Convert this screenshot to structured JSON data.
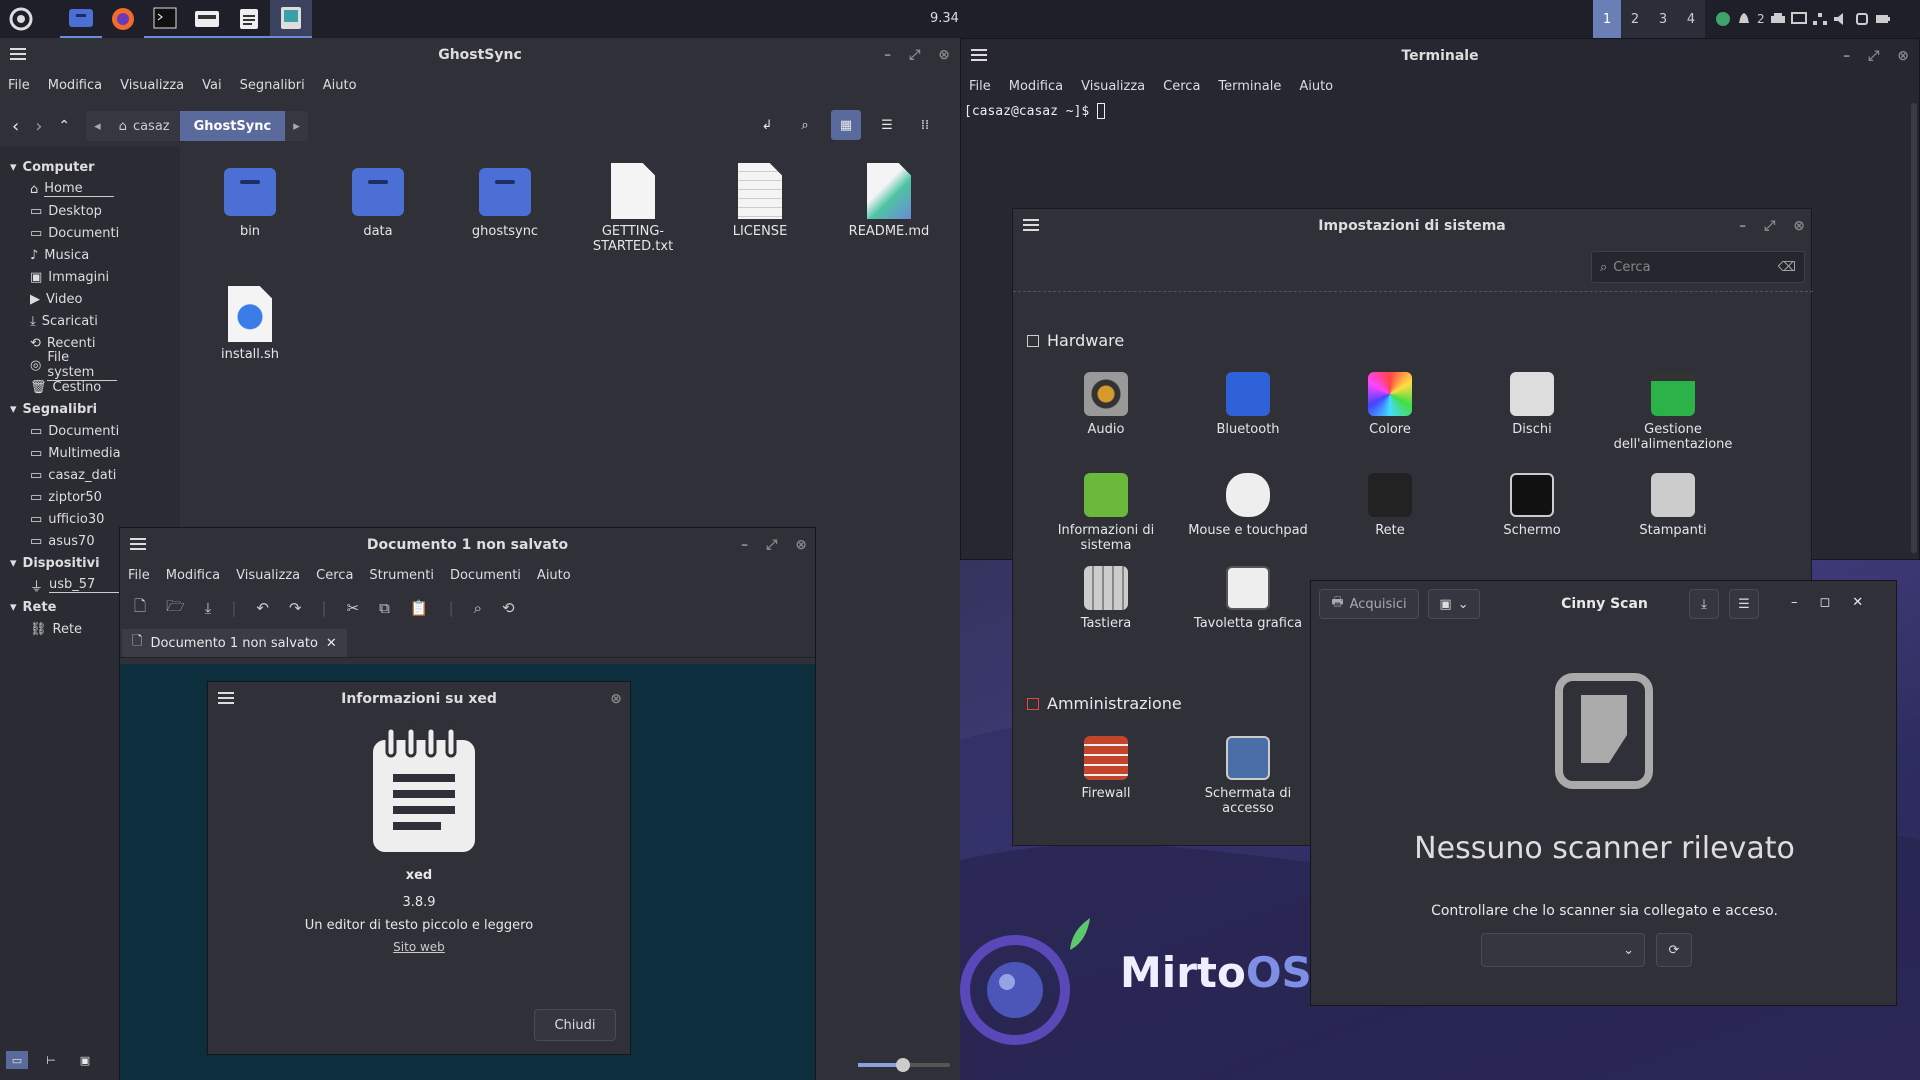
{
  "panel": {
    "clock": "9.34",
    "workspaces": [
      "1",
      "2",
      "3",
      "4"
    ],
    "tray_count": "2",
    "apps": [
      "menu-icon",
      "files-icon",
      "firefox-icon",
      "terminal-icon",
      "scanner-icon",
      "text-editor-icon",
      "settings-icon"
    ]
  },
  "file_manager": {
    "title": "GhostSync",
    "menu": [
      "File",
      "Modifica",
      "Visualizza",
      "Vai",
      "Segnalibri",
      "Aiuto"
    ],
    "path": [
      "casaz",
      "GhostSync"
    ],
    "sidebar": {
      "computer_header": "Computer",
      "computer": [
        "Home",
        "Desktop",
        "Documenti",
        "Musica",
        "Immagini",
        "Video",
        "Scaricati",
        "Recenti",
        "File system",
        "Cestino"
      ],
      "bookmarks_header": "Segnalibri",
      "bookmarks": [
        "Documenti",
        "Multimedia",
        "casaz_dati",
        "ziptor50",
        "ufficio30",
        "asus70"
      ],
      "devices_header": "Dispositivi",
      "devices": [
        "usb_57"
      ],
      "network_header": "Rete",
      "network": [
        "Rete"
      ]
    },
    "files": [
      "bin",
      "data",
      "ghostsync",
      "GETTING-STARTED.txt",
      "LICENSE",
      "README.md",
      "install.sh"
    ]
  },
  "terminal": {
    "title": "Terminale",
    "menu": [
      "File",
      "Modifica",
      "Visualizza",
      "Cerca",
      "Terminale",
      "Aiuto"
    ],
    "prompt": "[casaz@casaz ~]$ "
  },
  "settings": {
    "title": "Impostazioni di sistema",
    "search_placeholder": "Cerca",
    "hardware_header": "Hardware",
    "hardware": [
      "Audio",
      "Bluetooth",
      "Colore",
      "Dischi",
      "Gestione dell'alimentazione",
      "Informazioni di sistema",
      "Mouse e touchpad",
      "Rete",
      "Schermo",
      "Stampanti",
      "Tastiera",
      "Tavoletta grafica"
    ],
    "admin_header": "Amministrazione",
    "admin": [
      "Firewall",
      "Schermata di accesso"
    ]
  },
  "xed": {
    "title": "Documento 1 non salvato",
    "menu": [
      "File",
      "Modifica",
      "Visualizza",
      "Cerca",
      "Strumenti",
      "Documenti",
      "Aiuto"
    ],
    "tab": "Documento 1 non salvato"
  },
  "about": {
    "title": "Informazioni su xed",
    "app": "xed",
    "version": "3.8.9",
    "desc": "Un editor di testo piccolo e leggero",
    "link": "Sito web",
    "close": "Chiudi"
  },
  "scan": {
    "title": "Cinny Scan",
    "acquire": "Acquisici",
    "heading": "Nessuno scanner rilevato",
    "hint": "Controllare che lo scanner sia collegato e acceso."
  },
  "brand": {
    "name_a": "Mirto",
    "name_b": "OS"
  }
}
